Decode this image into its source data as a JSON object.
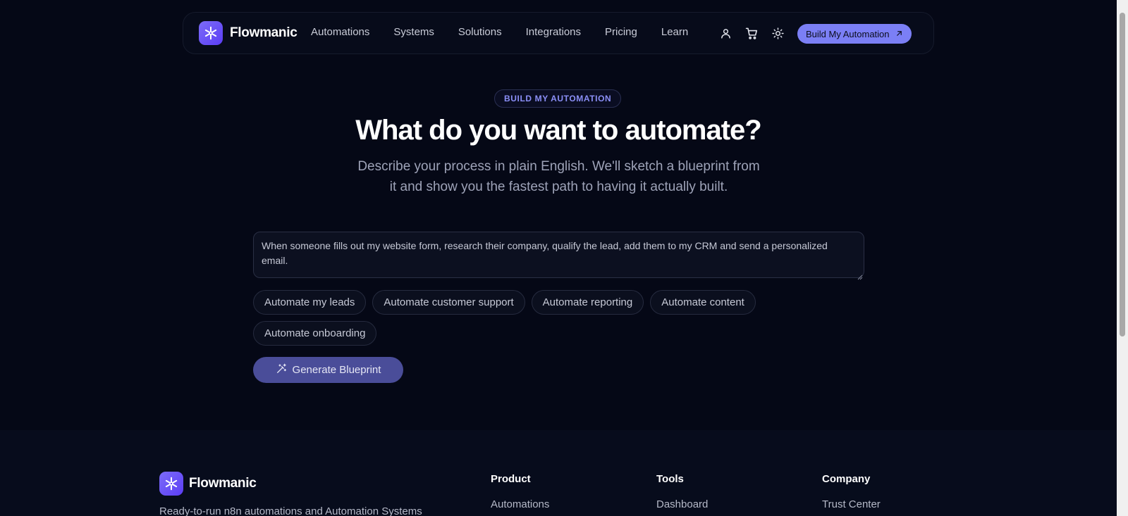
{
  "colors": {
    "background": "#050816",
    "accent": "#7b7ff5",
    "eyebrow_text": "#8b8ff7",
    "generate_button": "#4a4d99"
  },
  "brand": {
    "name": "Flowmanic",
    "icon": "snowflake-asterisk-icon"
  },
  "nav": {
    "links": [
      "Automations",
      "Systems",
      "Solutions",
      "Integrations",
      "Pricing",
      "Learn"
    ],
    "icons": [
      "user-icon",
      "cart-icon",
      "sun-icon"
    ],
    "cta_label": "Build My Automation",
    "cta_icon": "arrow-up-right-icon"
  },
  "hero": {
    "eyebrow": "BUILD MY AUTOMATION",
    "title": "What do you want to automate?",
    "subtitle": "Describe your process in plain English. We'll sketch a blueprint from it and show you the fastest path to having it actually built."
  },
  "form": {
    "prompt_value": "When someone fills out my website form, research their company, qualify the lead, add them to my CRM and send a personalized email.",
    "suggestions": [
      "Automate my leads",
      "Automate customer support",
      "Automate reporting",
      "Automate content",
      "Automate onboarding"
    ],
    "generate_label": "Generate Blueprint",
    "generate_icon": "magic-wand-icon"
  },
  "footer": {
    "tagline": "Ready-to-run n8n automations and Automation Systems",
    "columns": [
      {
        "title": "Product",
        "first_link": "Automations"
      },
      {
        "title": "Tools",
        "first_link": "Dashboard"
      },
      {
        "title": "Company",
        "first_link": "Trust Center"
      }
    ]
  }
}
